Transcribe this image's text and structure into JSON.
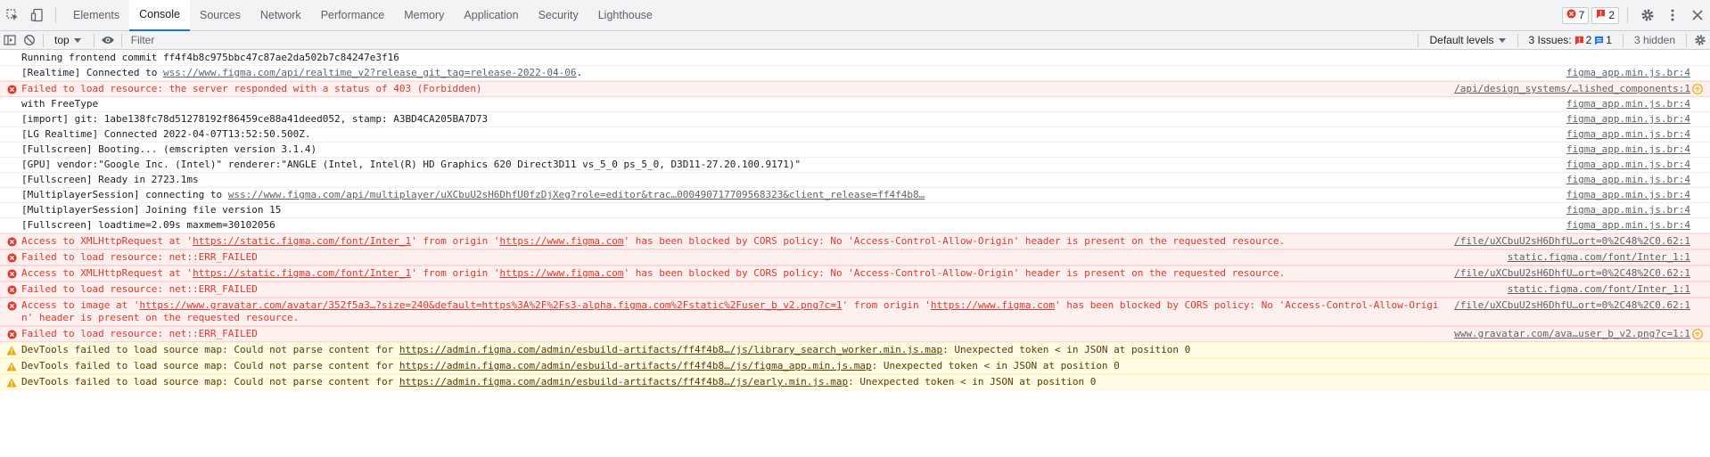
{
  "tabbar": {
    "tabs": [
      {
        "label": "Elements",
        "active": false
      },
      {
        "label": "Console",
        "active": true
      },
      {
        "label": "Sources",
        "active": false
      },
      {
        "label": "Network",
        "active": false
      },
      {
        "label": "Performance",
        "active": false
      },
      {
        "label": "Memory",
        "active": false
      },
      {
        "label": "Application",
        "active": false
      },
      {
        "label": "Security",
        "active": false
      },
      {
        "label": "Lighthouse",
        "active": false
      }
    ],
    "error_count": "7",
    "issue_count": "2"
  },
  "toolbar": {
    "context": "top",
    "filter_placeholder": "Filter",
    "levels_label": "Default levels",
    "issues_label": "3 Issues:",
    "issues_errors": "2",
    "issues_info": "1",
    "hidden_label": "3 hidden"
  },
  "colors": {
    "error": "#e0392b",
    "error_bg": "#fff0f0",
    "warning": "#f2a600",
    "warning_bg": "#fffbe5",
    "accent": "#1a73e8"
  },
  "messages": [
    {
      "level": "info",
      "parts": [
        {
          "t": "Running frontend commit ff4f4b8c975bbc47c87ae2da502b7c84247e3f16"
        }
      ],
      "source": ""
    },
    {
      "level": "info",
      "parts": [
        {
          "t": "[Realtime] Connected to "
        },
        {
          "t": "wss://www.figma.com/api/realtime_v2?release_git_tag=release-2022-04-06",
          "link": true
        },
        {
          "t": "."
        }
      ],
      "source": "figma_app.min.js.br:4"
    },
    {
      "level": "error",
      "parts": [
        {
          "t": "Failed to load resource: the server responded with a status of 403 (Forbidden)"
        }
      ],
      "source": "/api/design_systems/…lished_components:1",
      "issue": true
    },
    {
      "level": "info",
      "parts": [
        {
          "t": "with FreeType"
        }
      ],
      "source": "figma_app.min.js.br:4"
    },
    {
      "level": "info",
      "parts": [
        {
          "t": "[import] git: 1abe138fc78d51278192f86459ce88a41deed052, stamp: A3BD4CA205BA7D73"
        }
      ],
      "source": "figma_app.min.js.br:4"
    },
    {
      "level": "info",
      "parts": [
        {
          "t": "[LG Realtime] Connected 2022-04-07T13:52:50.500Z."
        }
      ],
      "source": "figma_app.min.js.br:4"
    },
    {
      "level": "info",
      "parts": [
        {
          "t": "[Fullscreen] Booting... (emscripten version 3.1.4)"
        }
      ],
      "source": "figma_app.min.js.br:4"
    },
    {
      "level": "info",
      "parts": [
        {
          "t": "[GPU] vendor:\"Google Inc. (Intel)\" renderer:\"ANGLE (Intel, Intel(R) HD Graphics 620 Direct3D11 vs_5_0 ps_5_0, D3D11-27.20.100.9171)\""
        }
      ],
      "source": "figma_app.min.js.br:4"
    },
    {
      "level": "info",
      "parts": [
        {
          "t": "[Fullscreen] Ready in 2723.1ms"
        }
      ],
      "source": "figma_app.min.js.br:4"
    },
    {
      "level": "info",
      "parts": [
        {
          "t": "[MultiplayerSession] connecting to "
        },
        {
          "t": "wss://www.figma.com/api/multiplayer/uXCbuU2sH6DhfU0fzDjXeg?role=editor&trac…000490717709568323&client_release=ff4f4b8…",
          "link": true
        }
      ],
      "source": "figma_app.min.js.br:4"
    },
    {
      "level": "info",
      "parts": [
        {
          "t": "[MultiplayerSession] Joining file version 15"
        }
      ],
      "source": "figma_app.min.js.br:4"
    },
    {
      "level": "info",
      "parts": [
        {
          "t": "[Fullscreen] loadtime=2.09s maxmem=30102056"
        }
      ],
      "source": "figma_app.min.js.br:4"
    },
    {
      "level": "error",
      "parts": [
        {
          "t": "Access to XMLHttpRequest at '"
        },
        {
          "t": "https://static.figma.com/font/Inter_1",
          "link": true
        },
        {
          "t": "' from origin '"
        },
        {
          "t": "https://www.figma.com",
          "link": true
        },
        {
          "t": "' has been blocked by CORS policy: No 'Access-Control-Allow-Origin' header is present on the requested resource."
        }
      ],
      "source": "/file/uXCbuU2sH6DhfU…ort=0%2C48%2C0.62:1"
    },
    {
      "level": "error",
      "parts": [
        {
          "t": "Failed to load resource: net::ERR_FAILED"
        }
      ],
      "source": "static.figma.com/font/Inter_1:1"
    },
    {
      "level": "error",
      "parts": [
        {
          "t": "Access to XMLHttpRequest at '"
        },
        {
          "t": "https://static.figma.com/font/Inter_1",
          "link": true
        },
        {
          "t": "' from origin '"
        },
        {
          "t": "https://www.figma.com",
          "link": true
        },
        {
          "t": "' has been blocked by CORS policy: No 'Access-Control-Allow-Origin' header is present on the requested resource."
        }
      ],
      "source": "/file/uXCbuU2sH6DhfU…ort=0%2C48%2C0.62:1"
    },
    {
      "level": "error",
      "parts": [
        {
          "t": "Failed to load resource: net::ERR_FAILED"
        }
      ],
      "source": "static.figma.com/font/Inter_1:1"
    },
    {
      "level": "error",
      "parts": [
        {
          "t": "Access to image at '"
        },
        {
          "t": "https://www.gravatar.com/avatar/352f5a3…?size=240&default=https%3A%2F%2Fs3-alpha.figma.com%2Fstatic%2Fuser_b_v2.png?c=1",
          "link": true
        },
        {
          "t": "' from origin '"
        },
        {
          "t": "https://www.figma.com",
          "link": true
        },
        {
          "t": "' has been blocked by CORS policy: No 'Access-Control-Allow-Origin' header is present on the requested resource."
        }
      ],
      "source": "/file/uXCbuU2sH6DhfU…ort=0%2C48%2C0.62:1"
    },
    {
      "level": "error",
      "parts": [
        {
          "t": "Failed to load resource: net::ERR_FAILED"
        }
      ],
      "source": "www.gravatar.com/ava…user_b_v2.png?c=1:1",
      "issue": true
    },
    {
      "level": "warning",
      "parts": [
        {
          "t": "DevTools failed to load source map: Could not parse content for "
        },
        {
          "t": "https://admin.figma.com/admin/esbuild-artifacts/ff4f4b8…/js/library_search_worker.min.js.map",
          "link": true
        },
        {
          "t": ": Unexpected token < in JSON at position 0"
        }
      ],
      "source": ""
    },
    {
      "level": "warning",
      "parts": [
        {
          "t": "DevTools failed to load source map: Could not parse content for "
        },
        {
          "t": "https://admin.figma.com/admin/esbuild-artifacts/ff4f4b8…/js/figma_app.min.js.map",
          "link": true
        },
        {
          "t": ": Unexpected token < in JSON at position 0"
        }
      ],
      "source": ""
    },
    {
      "level": "warning",
      "parts": [
        {
          "t": "DevTools failed to load source map: Could not parse content for "
        },
        {
          "t": "https://admin.figma.com/admin/esbuild-artifacts/ff4f4b8…/js/early.min.js.map",
          "link": true
        },
        {
          "t": ": Unexpected token < in JSON at position 0"
        }
      ],
      "source": ""
    }
  ]
}
